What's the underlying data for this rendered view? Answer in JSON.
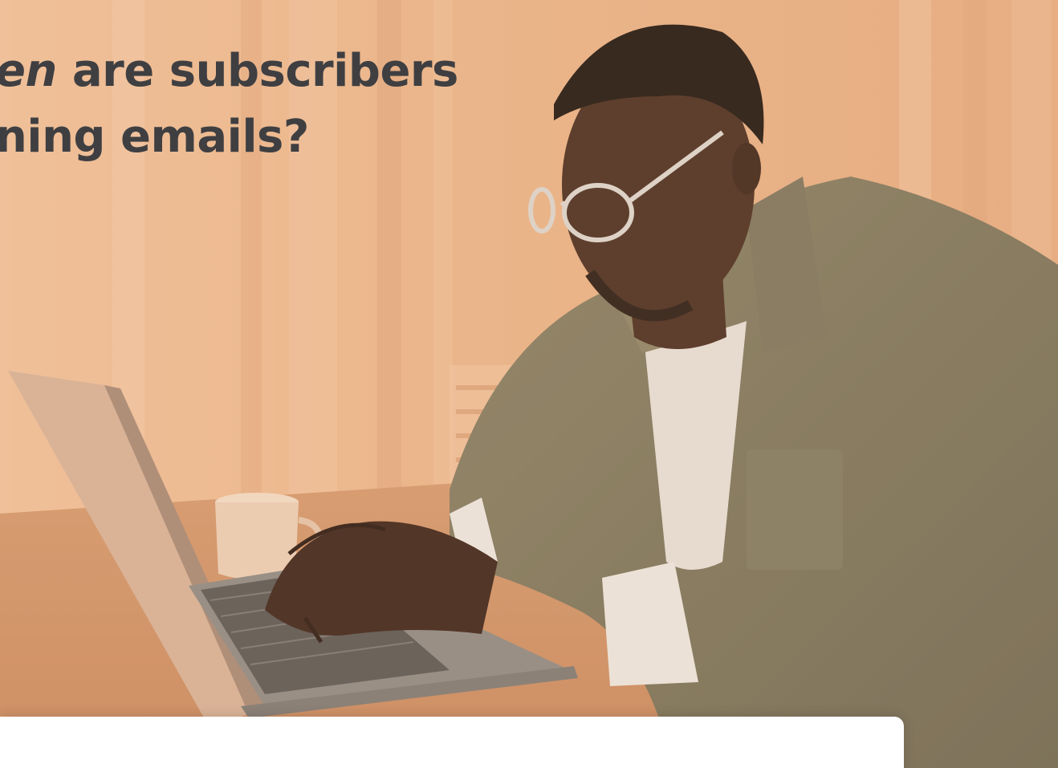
{
  "hero": {
    "headline_line1_italic": "en",
    "headline_line1_rest": " are subscribers",
    "headline_line2": "ning emails?"
  },
  "colors": {
    "background_tint": "#e8b48e",
    "headline_text": "#3f3f42",
    "card_background": "#ffffff"
  }
}
